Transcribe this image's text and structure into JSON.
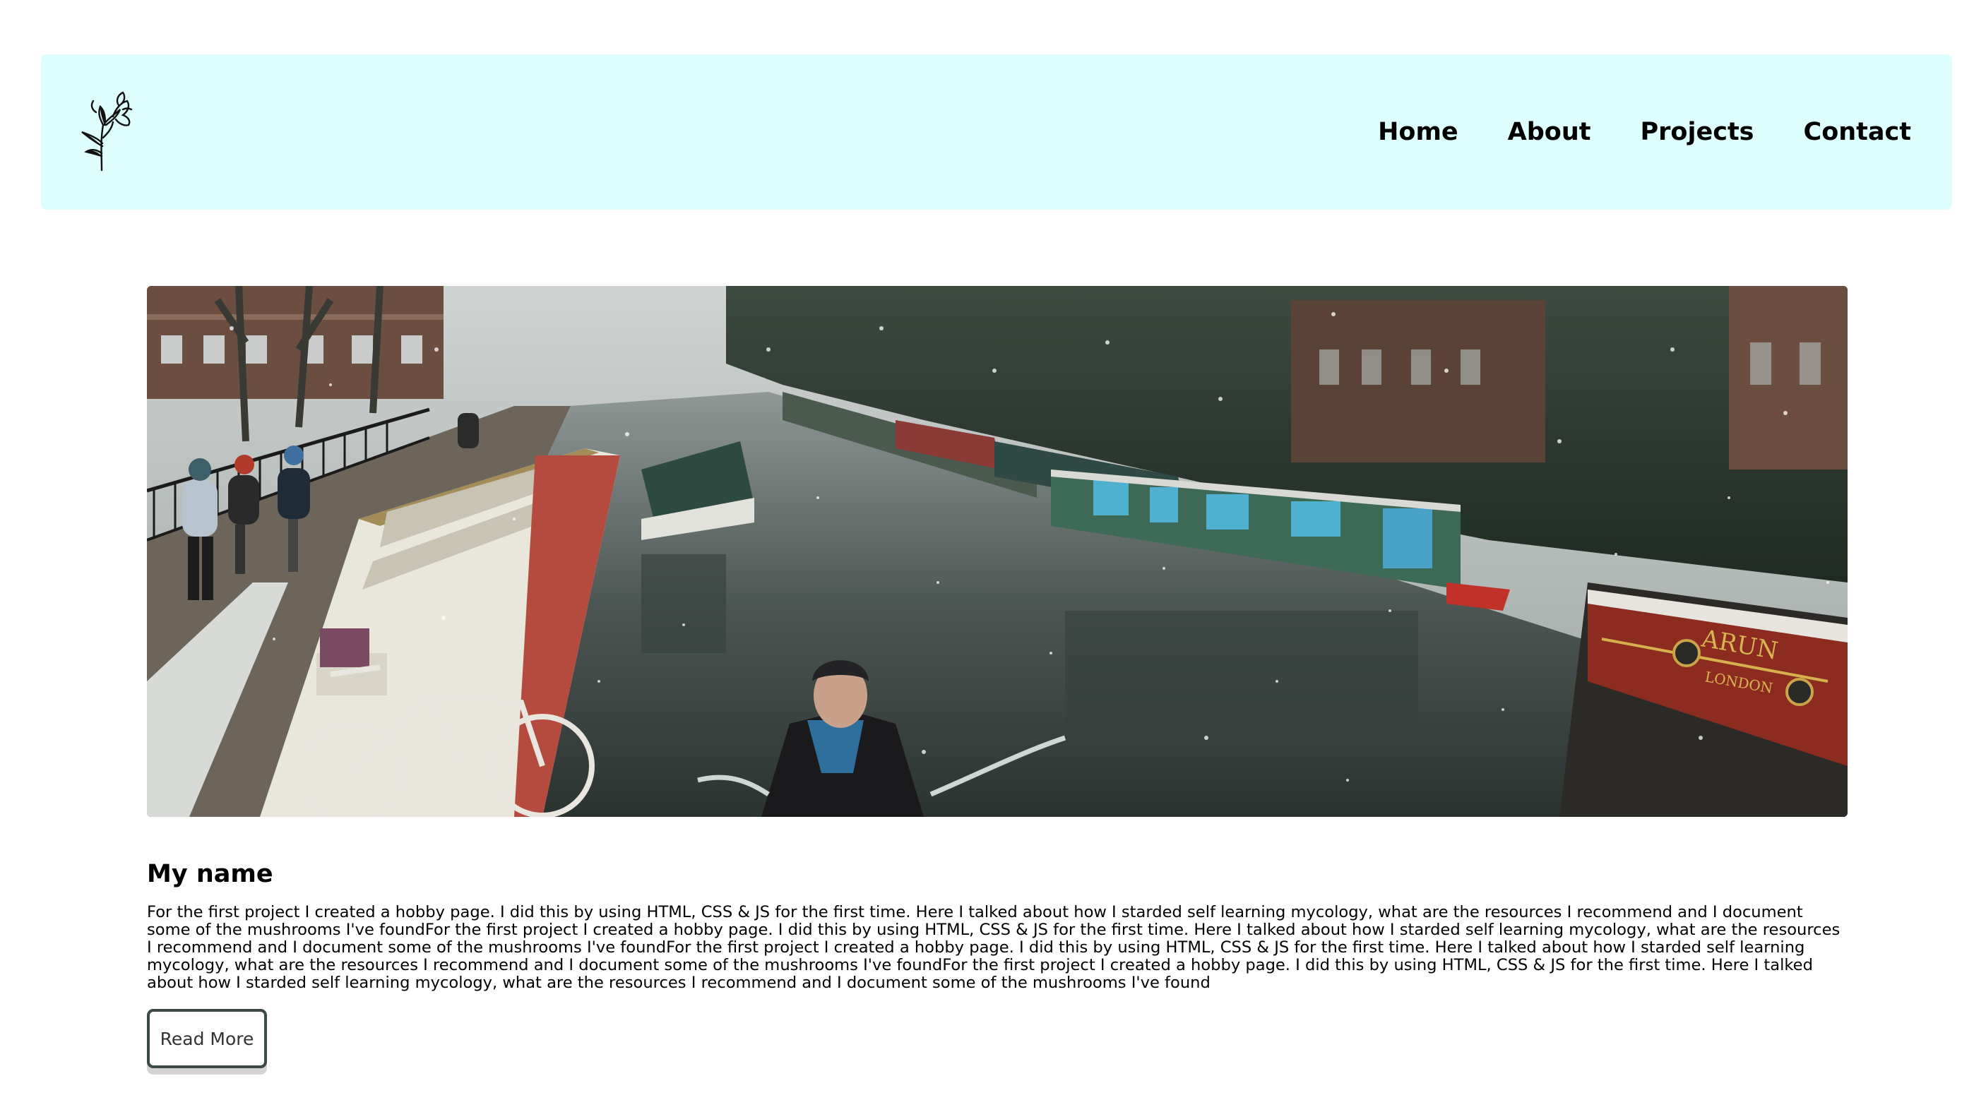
{
  "nav": {
    "logo_icon": "flower-sketch-icon",
    "links": [
      {
        "label": "Home"
      },
      {
        "label": "About"
      },
      {
        "label": "Projects"
      },
      {
        "label": "Contact"
      }
    ]
  },
  "hero": {
    "image_icon": "canal-boats-snow-photo"
  },
  "content": {
    "title": "My name",
    "body": "For the first project I created a hobby page. I did this by using HTML, CSS & JS for the first time. Here I talked about how I starded self learning mycology, what are the resources I recommend and I document some of the mushrooms I've foundFor the first project I created a hobby page. I did this by using HTML, CSS & JS for the first time. Here I talked about how I starded self learning mycology, what are the resources I recommend and I document some of the mushrooms I've foundFor the first project I created a hobby page. I did this by using HTML, CSS & JS for the first time. Here I talked about how I starded self learning mycology, what are the resources I recommend and I document some of the mushrooms I've foundFor the first project I created a hobby page. I did this by using HTML, CSS & JS for the first time. Here I talked about how I starded self learning mycology, what are the resources I recommend and I document some of the mushrooms I've found",
    "read_more_label": "Read More"
  },
  "colors": {
    "navbar_bg": "#dffffe",
    "button_border": "#3b4a44"
  }
}
